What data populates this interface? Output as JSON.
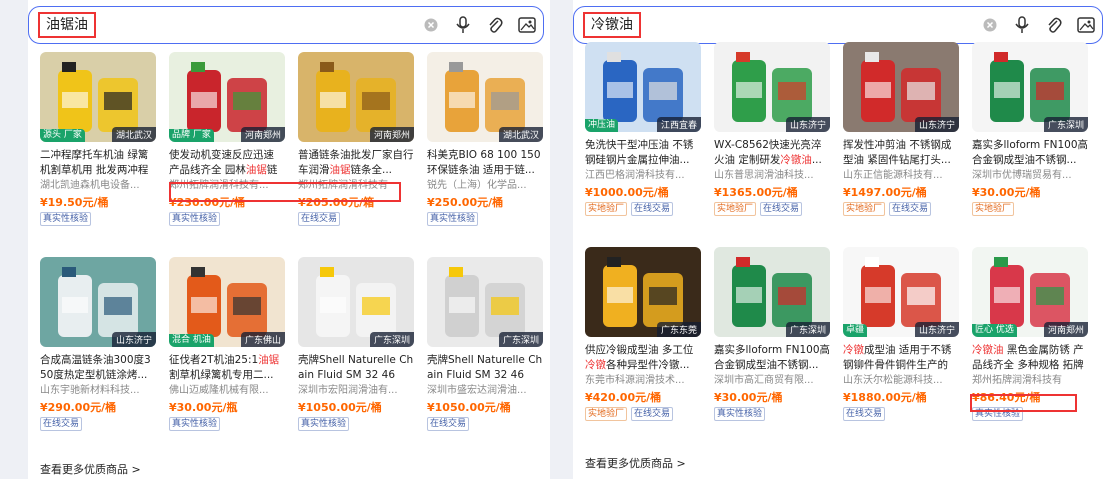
{
  "left": {
    "query": "油锯油",
    "more_label": "查看更多优质商品 >",
    "cards": [
      {
        "title": "二冲程摩托车机油 绿篱机割草机用 批发两冲程",
        "seller": "湖北凯迪森机电设备...",
        "price": "¥19.50元/桶",
        "badges": [
          "真实性核验"
        ],
        "tag": "湖北武汉",
        "ltag": "源头 厂家",
        "img": "yellow"
      },
      {
        "title_parts": [
          "使发动机变速反应迅速 产品线齐全 园林",
          "油锯",
          "链条油"
        ],
        "seller": "郑州拓牌润滑科技有...",
        "price": "¥230.00元/桶",
        "badges": [
          "真实性核验"
        ],
        "tag": "河南郑州",
        "ltag": "品牌 厂家",
        "img": "bottles-red"
      },
      {
        "title_parts": [
          "普通链条油批发厂家自行车润滑",
          "油锯",
          "链条全..."
        ],
        "seller": "郑州拓牌润滑科技有",
        "price": "¥205.00元/箱",
        "badges": [
          "在线交易"
        ],
        "tag": "河南郑州",
        "img": "bottles-amber"
      },
      {
        "title": "科美克BIO 68 100 150 环保链条油 适用于链...",
        "seller": "锐先（上海）化学品...",
        "price": "¥250.00元/桶",
        "badges": [
          "真实性核验"
        ],
        "tag": "湖北武汉",
        "img": "doc"
      },
      {
        "title": "合成高温链条油300度350度热定型机链涂烤...",
        "seller": "山东宇驰新材料科技...",
        "price": "¥290.00元/桶",
        "badges": [
          "在线交易"
        ],
        "tag": "山东济宁",
        "img": "drums-teal"
      },
      {
        "title_parts": [
          "征伐者2T机油25:1",
          "油锯",
          "割草机绿篱机专用二..."
        ],
        "seller": "佛山迈威隆机械有限...",
        "price": "¥30.00元/瓶",
        "badges": [
          "真实性核验"
        ],
        "tag": "广东佛山",
        "ltag": "混合 机油",
        "img": "bottles-orange"
      },
      {
        "title": "壳牌Shell Naturelle Chain Fluid SM 32 46号...",
        "seller": "深圳市宏阳润滑油有...",
        "price": "¥1050.00元/桶",
        "badges": [
          "真实性核验"
        ],
        "tag": "广东深圳",
        "img": "pail-shell"
      },
      {
        "title": "壳牌Shell Naturelle Chain Fluid SM 32 46号...",
        "seller": "深圳市盛宏达润滑油...",
        "price": "¥1050.00元/桶",
        "badges": [
          "在线交易"
        ],
        "tag": "广东深圳",
        "img": "pail-shell2"
      }
    ]
  },
  "right": {
    "query": "冷镦油",
    "more_label": "查看更多优质商品 >",
    "cards": [
      {
        "title": "免洗快干型冲压油 不锈钢硅钢片金属拉伸油...",
        "seller": "江西巴格润滑科技有...",
        "price": "¥1000.00元/桶",
        "badges": [
          "实地验厂",
          "在线交易"
        ],
        "tag": "江西宜春",
        "ltag": "冲压油",
        "img": "drums-blue"
      },
      {
        "title_parts": [
          "WX-C8562快速光亮淬火油 定制研发",
          "冷镦油",
          "..."
        ],
        "seller": "山东普思润滑油科技...",
        "price": "¥1365.00元/桶",
        "badges": [
          "实地验厂",
          "在线交易"
        ],
        "tag": "山东济宁",
        "img": "drum-green"
      },
      {
        "title": "挥发性冲剪油 不锈钢成型油 紧固件钻尾打头...",
        "seller": "山东正信能源科技有...",
        "price": "¥1497.00元/桶",
        "badges": [
          "实地验厂",
          "在线交易"
        ],
        "tag": "山东济宁",
        "img": "drum-red"
      },
      {
        "title": "嘉实多lloform FN100高合金钢成型油不锈钢...",
        "seller": "深圳市优博瑞贸易有...",
        "price": "¥30.00元/桶",
        "badges": [
          "实地验厂"
        ],
        "tag": "广东深圳",
        "img": "drum-castrol"
      },
      {
        "title_parts": [
          "供应冷锻成型油 多工位",
          "冷镦",
          "各种异型件冷镦..."
        ],
        "seller": "东莞市科源润滑技术...",
        "price": "¥420.00元/桶",
        "badges": [
          "实地验厂",
          "在线交易"
        ],
        "tag": "广东东莞",
        "img": "cold-forge"
      },
      {
        "title": "嘉实多lloform FN100高合金钢成型油不锈钢...",
        "seller": "深圳市高汇商贸有限...",
        "price": "¥30.00元/桶",
        "badges": [
          "真实性核验"
        ],
        "tag": "广东深圳",
        "img": "drum-castrol2"
      },
      {
        "title_parts": [
          "",
          "冷镦",
          "成型油 适用于不锈钢铆件骨件铜件生产的各..."
        ],
        "seller": "山东沃尔松能源科技...",
        "price": "¥1880.00元/桶",
        "badges": [
          "在线交易"
        ],
        "tag": "山东济宁",
        "ltag": "卓疆",
        "img": "drum-white"
      },
      {
        "title_parts": [
          "",
          "冷镦油",
          " 黑色金属防锈 产品线齐全 多种规格 拓牌"
        ],
        "seller": "郑州拓牌润滑科技有",
        "price": "¥86.40元/桶",
        "badges": [
          "真实性核验"
        ],
        "tag": "河南郑州",
        "ltag": "匠心 优选",
        "img": "tubes"
      }
    ]
  }
}
